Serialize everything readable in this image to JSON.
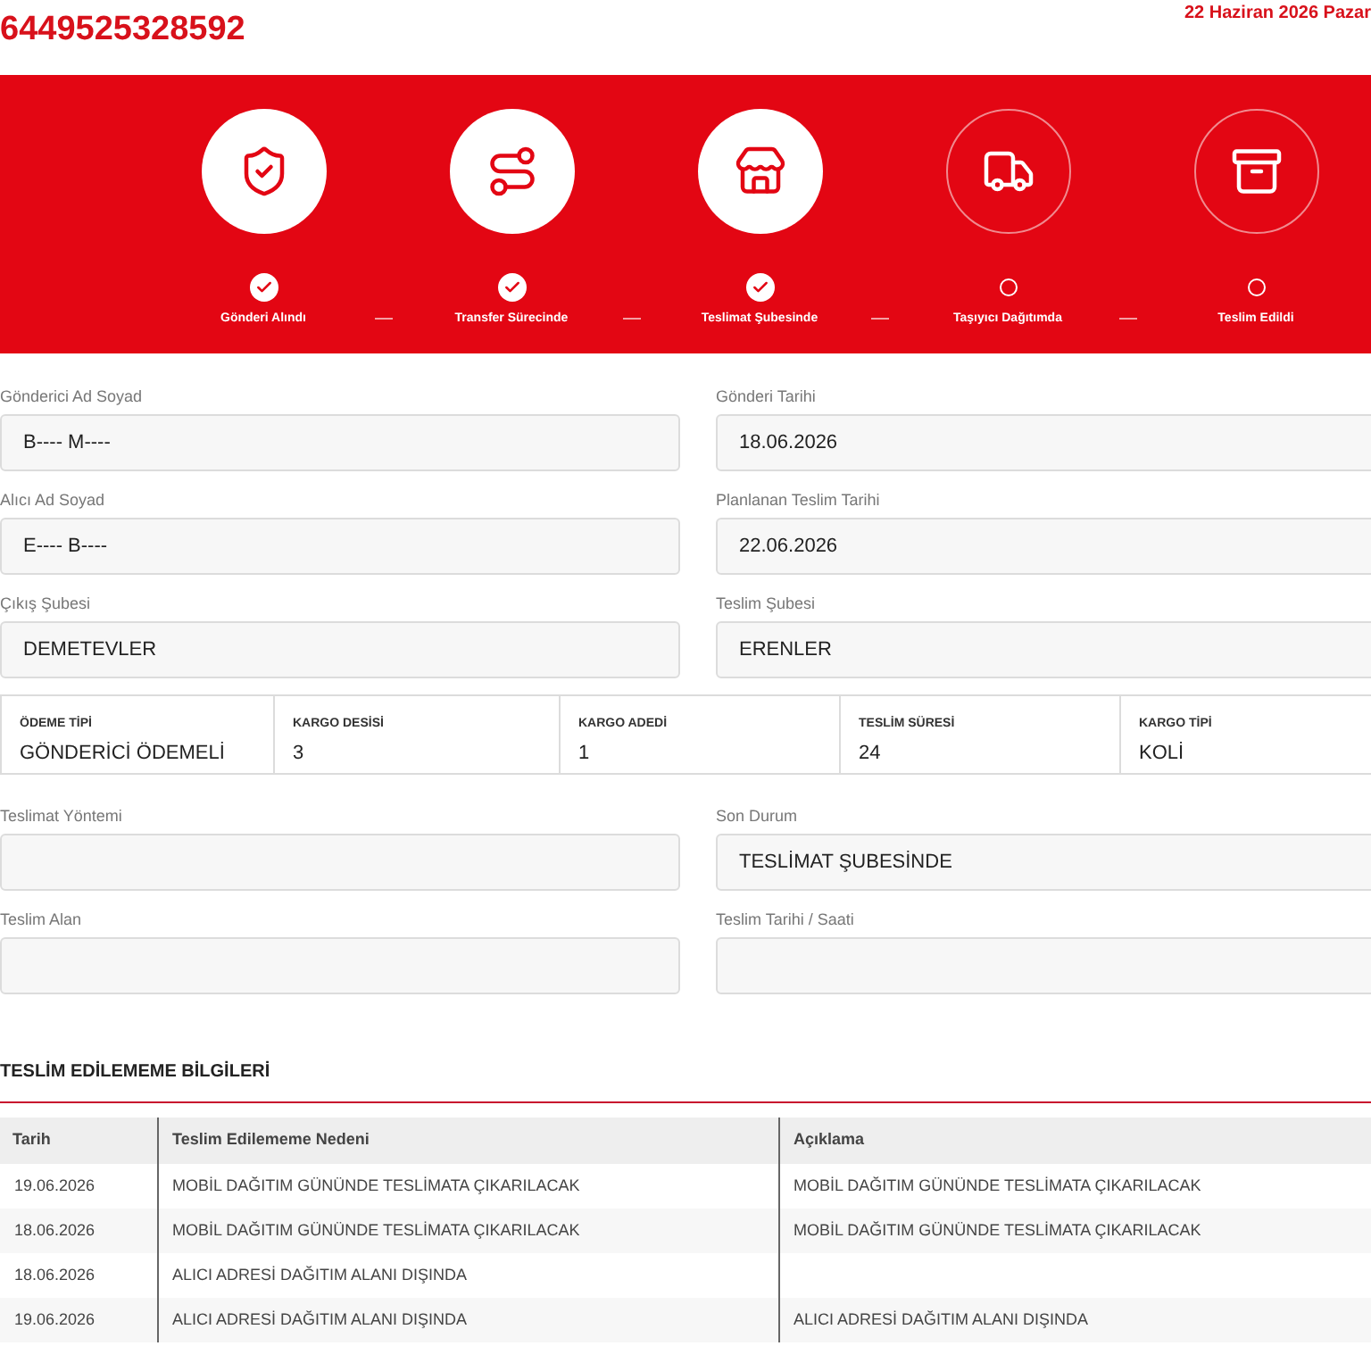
{
  "header": {
    "tracking_number": "6449525328592",
    "date": "22 Haziran 2026 Pazar"
  },
  "steps": [
    {
      "label": "Gönderi Alındı",
      "kind": "shield",
      "done": true
    },
    {
      "label": "Transfer Sürecinde",
      "kind": "route",
      "done": true
    },
    {
      "label": "Teslimat Şubesinde",
      "kind": "store",
      "done": true
    },
    {
      "label": "Taşıyıcı Dağıtımda",
      "kind": "truck",
      "done": false
    },
    {
      "label": "Teslim Edildi",
      "kind": "box",
      "done": false
    }
  ],
  "fields_top": [
    {
      "label": "Gönderici Ad Soyad",
      "value": "B---- M----"
    },
    {
      "label": "Gönderi Tarihi",
      "value": "18.06.2026"
    },
    {
      "label": "Alıcı Ad Soyad",
      "value": "E---- B----"
    },
    {
      "label": "Planlanan Teslim Tarihi",
      "value": "22.06.2026"
    },
    {
      "label": "Çıkış Şubesi",
      "value": "DEMETEVLER"
    },
    {
      "label": "Teslim Şubesi",
      "value": "ERENLER"
    }
  ],
  "summary": [
    {
      "label": "ÖDEME TİPİ",
      "value": "GÖNDERİCİ ÖDEMELİ"
    },
    {
      "label": "KARGO DESİSİ",
      "value": "3"
    },
    {
      "label": "KARGO ADEDİ",
      "value": "1"
    },
    {
      "label": "TESLİM SÜRESİ",
      "value": "24"
    },
    {
      "label": "KARGO TİPİ",
      "value": "KOLİ"
    }
  ],
  "fields_bottom": [
    {
      "label": "Teslimat Yöntemi"
    },
    {
      "label": "Son Durum",
      "value": "TESLİMAT ŞUBESİNDE"
    },
    {
      "label": "Teslim Alan"
    },
    {
      "label": "Teslim Tarihi / Saati"
    }
  ],
  "failed_delivery": {
    "title": "TESLİM EDİLEMEME BİLGİLERİ",
    "columns": [
      "Tarih",
      "Teslim Edilememe Nedeni",
      "Açıklama"
    ],
    "rows": [
      [
        "19.06.2026",
        "MOBİL DAĞITIM GÜNÜNDE TESLİMATA ÇIKARILACAK",
        "MOBİL DAĞITIM GÜNÜNDE TESLİMATA ÇIKARILACAK"
      ],
      [
        "18.06.2026",
        "MOBİL DAĞITIM GÜNÜNDE TESLİMATA ÇIKARILACAK",
        "MOBİL DAĞITIM GÜNÜNDE TESLİMATA ÇIKARILACAK"
      ],
      [
        "18.06.2026",
        "ALICI ADRESİ DAĞITIM ALANI DIŞINDA",
        null
      ],
      [
        "19.06.2026",
        "ALICI ADRESİ DAĞITIM ALANI DIŞINDA",
        "ALICI ADRESİ DAĞITIM ALANI DIŞINDA"
      ]
    ]
  }
}
